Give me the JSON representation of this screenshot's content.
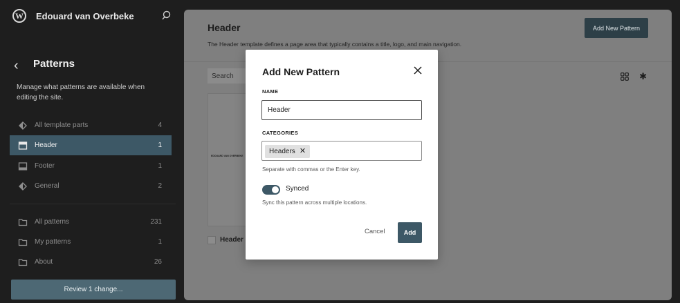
{
  "site": {
    "name": "Edouard van Overbeke"
  },
  "sidebar": {
    "title": "Patterns",
    "description": "Manage what patterns are available when editing the site.",
    "template_parts": [
      {
        "label": "All template parts",
        "count": "4",
        "icon": "diamond-icon"
      },
      {
        "label": "Header",
        "count": "1",
        "icon": "header-icon",
        "active": true
      },
      {
        "label": "Footer",
        "count": "1",
        "icon": "footer-icon"
      },
      {
        "label": "General",
        "count": "2",
        "icon": "diamond-icon"
      }
    ],
    "patterns": [
      {
        "label": "All patterns",
        "count": "231",
        "icon": "folder-icon"
      },
      {
        "label": "My patterns",
        "count": "1",
        "icon": "folder-icon"
      },
      {
        "label": "About",
        "count": "26",
        "icon": "folder-icon"
      }
    ],
    "review_button": "Review 1 change..."
  },
  "main": {
    "title": "Header",
    "description": "The Header template defines a page area that typically contains a title, logo, and main navigation.",
    "add_pattern_button": "Add New Pattern",
    "search_placeholder": "Search",
    "card": {
      "preview_text": "EDOUARD VAN OVERBEKE",
      "label": "Header"
    }
  },
  "modal": {
    "title": "Add New Pattern",
    "name_label": "NAME",
    "name_value": "Header",
    "categories_label": "CATEGORIES",
    "category_token": "Headers",
    "categories_help": "Separate with commas or the Enter key.",
    "synced_label": "Synced",
    "synced_on": true,
    "synced_help": "Sync this pattern across multiple locations.",
    "cancel_button": "Cancel",
    "add_button": "Add"
  },
  "colors": {
    "accent": "#3d5866",
    "sidebar_bg": "#1e1e1e",
    "overlay_content": "#7f7f7f"
  }
}
